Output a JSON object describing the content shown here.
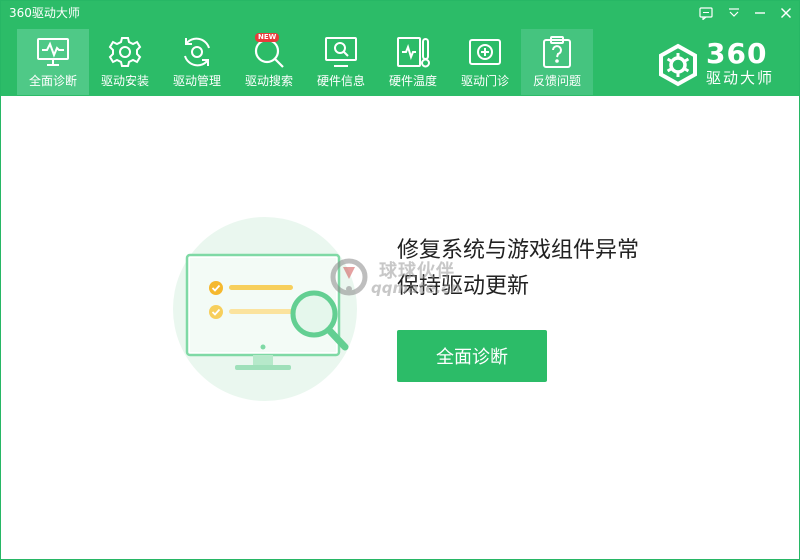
{
  "window": {
    "title": "360驱动大师",
    "accent": "#2cbc68"
  },
  "nav": {
    "items": [
      {
        "label": "全面诊断",
        "icon": "monitor-pulse-icon",
        "active": true
      },
      {
        "label": "驱动安装",
        "icon": "gear-icon"
      },
      {
        "label": "驱动管理",
        "icon": "refresh-gear-icon"
      },
      {
        "label": "驱动搜索",
        "icon": "search-icon",
        "badge": "NEW"
      },
      {
        "label": "硬件信息",
        "icon": "monitor-search-icon"
      },
      {
        "label": "硬件温度",
        "icon": "thermometer-icon"
      },
      {
        "label": "驱动门诊",
        "icon": "first-aid-icon"
      },
      {
        "label": "反馈问题",
        "icon": "feedback-question-icon"
      }
    ]
  },
  "logo": {
    "number": "360",
    "subtitle": "驱动大师"
  },
  "main": {
    "headline_line1": "修复系统与游戏组件异常",
    "headline_line2": "保持驱动更新",
    "scan_button": "全面诊断"
  },
  "watermark": {
    "text_cn": "球球伙伴",
    "text_en": "qqmate.cn"
  }
}
